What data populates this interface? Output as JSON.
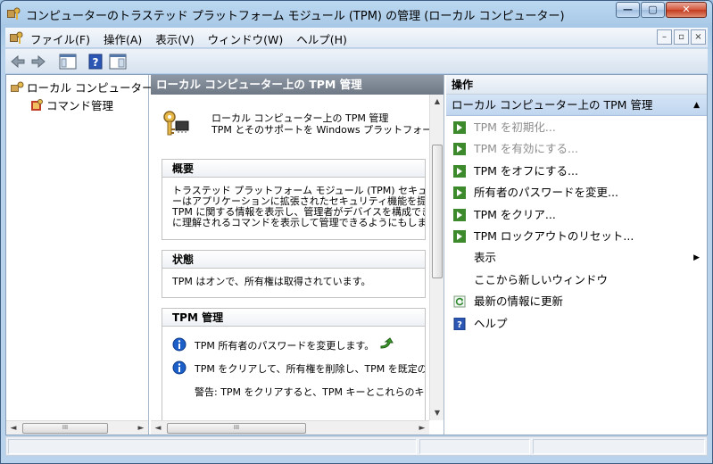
{
  "window": {
    "title": "コンピューターのトラステッド プラットフォーム モジュール (TPM) の管理 (ローカル コンピューター)",
    "controls": {
      "minimize": "—",
      "maximize": "▢",
      "close": "✕"
    }
  },
  "menu": {
    "items": [
      "ファイル(F)",
      "操作(A)",
      "表示(V)",
      "ウィンドウ(W)",
      "ヘルプ(H)"
    ],
    "mdi": {
      "minimize": "–",
      "restore": "▫",
      "close": "×"
    }
  },
  "tree": {
    "root": "ローカル コンピューター上",
    "child": "コマンド管理"
  },
  "center": {
    "header": "ローカル コンピューター上の TPM 管理",
    "intro_line1": "ローカル コンピューター上の TPM 管理",
    "intro_line2": "TPM とそのサポートを Windows プラットフォームで構",
    "overview": {
      "title": "概要",
      "lines": [
        "トラステッド プラットフォーム モジュール (TPM) セキュリティ ハー",
        "ーはアプリケーションに拡張されたセキュリティ機能を提供します",
        "TPM に関する情報を表示し、管理者がデバイスを構成できる",
        "に理解されるコマンドを表示して管理できるようにもします。"
      ]
    },
    "status": {
      "title": "状態",
      "text": "TPM はオンで、所有権は取得されています。"
    },
    "mgmt": {
      "title": "TPM 管理",
      "item1": "TPM 所有者のパスワードを変更します。",
      "item2": "TPM をクリアして、所有権を削除し、TPM を既定の設",
      "warning": "警告: TPM をクリアすると、TPM キーとこれらのキーで保"
    }
  },
  "scrollbars": {
    "left": "◄",
    "right": "►",
    "up": "▲",
    "down": "▼",
    "grip": "III"
  },
  "actions": {
    "header": "操作",
    "section": "ローカル コンピューター上の TPM 管理",
    "section_arrow": "▲",
    "items": [
      {
        "label": "TPM を初期化...",
        "disabled": true
      },
      {
        "label": "TPM を有効にする...",
        "disabled": true
      },
      {
        "label": "TPM をオフにする...",
        "disabled": false
      },
      {
        "label": "所有者のパスワードを変更...",
        "disabled": false
      },
      {
        "label": "TPM をクリア...",
        "disabled": false
      },
      {
        "label": "TPM ロックアウトのリセット...",
        "disabled": false
      },
      {
        "label": "表示",
        "submenu": "▶"
      },
      {
        "label": "ここから新しいウィンドウ"
      },
      {
        "label": "最新の情報に更新"
      },
      {
        "label": "ヘルプ"
      }
    ]
  },
  "colors": {
    "accent_green": "#3c9a2c",
    "header_gray": "#7b8490",
    "section_blue": "#c6daf1",
    "title_gradient_top": "#bcd8f1",
    "info_blue": "#1c5fc8"
  },
  "icons": {
    "app": "tpm-chip-key-icon",
    "back": "back-arrow-icon",
    "forward": "forward-arrow-icon",
    "show_tree": "console-tree-icon",
    "help": "help-icon",
    "action_pane": "action-pane-icon",
    "tree_root": "computer-key-icon",
    "tree_child": "command-key-icon",
    "action": "action-arrow-icon",
    "refresh": "refresh-icon",
    "info": "info-icon",
    "link": "green-arrow-icon"
  }
}
